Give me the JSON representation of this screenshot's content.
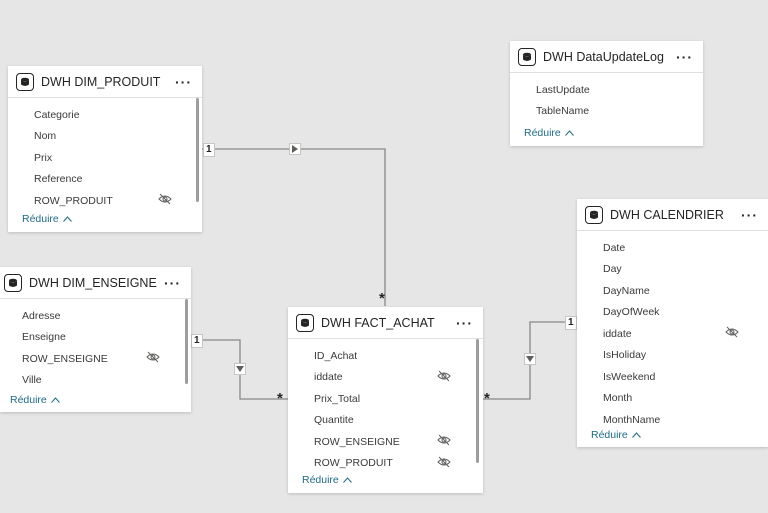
{
  "tables": {
    "produit": {
      "title": "DWH DIM_PRODUIT",
      "fields": [
        "Categorie",
        "Nom",
        "Prix",
        "Reference",
        "ROW_PRODUIT"
      ],
      "reduce": "Réduire"
    },
    "datalog": {
      "title": "DWH DataUpdateLog",
      "fields": [
        "LastUpdate",
        "TableName"
      ],
      "reduce": "Réduire"
    },
    "enseigne": {
      "title": "DWH DIM_ENSEIGNE",
      "fields": [
        "Adresse",
        "Enseigne",
        "ROW_ENSEIGNE",
        "Ville"
      ],
      "reduce": "Réduire"
    },
    "fact": {
      "title": "DWH FACT_ACHAT",
      "fields": [
        "ID_Achat",
        "iddate",
        "Prix_Total",
        "Quantite",
        "ROW_ENSEIGNE",
        "ROW_PRODUIT"
      ],
      "reduce": "Réduire"
    },
    "calendrier": {
      "title": "DWH CALENDRIER",
      "fields": [
        "Date",
        "Day",
        "DayName",
        "DayOfWeek",
        "iddate",
        "IsHoliday",
        "IsWeekend",
        "Month",
        "MonthName"
      ],
      "reduce": "Réduire"
    }
  },
  "more_label": "···",
  "relationships": {
    "one": "1",
    "many": "*"
  }
}
